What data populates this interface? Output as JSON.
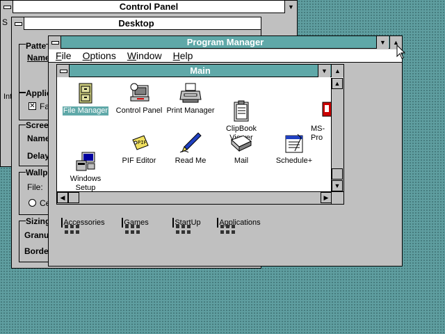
{
  "control_panel": {
    "title": "Control Panel",
    "partial_left_text": "Int",
    "partial_edge_text": "S"
  },
  "desktop": {
    "title": "Desktop",
    "pattern_label": "Patte",
    "name_label": "Name",
    "applications_label": "Applic",
    "fast_label": "Fa",
    "screensaver_label": "Scree",
    "name2_label": "Name",
    "delay_label": "Delay",
    "wallpaper_label": "Wallp",
    "file_label": "File:",
    "center_label": "Ce",
    "sizing_label": "Sizing",
    "granularity_label": "Granu",
    "border_label": "Borde"
  },
  "program_manager": {
    "title": "Program Manager",
    "menu": [
      "File",
      "Options",
      "Window",
      "Help"
    ]
  },
  "main_group": {
    "title": "Main",
    "items": [
      {
        "label": "File Manager",
        "icon": "file-cabinet-icon",
        "selected": true
      },
      {
        "label": "Control Panel",
        "icon": "control-panel-icon"
      },
      {
        "label": "Print Manager",
        "icon": "printer-icon"
      },
      {
        "label": "ClipBook\nViewer",
        "icon": "clipbook-icon"
      },
      {
        "label": "MS-\nPro",
        "icon": "ms-dos-icon"
      },
      {
        "label": "Windows\nSetup",
        "icon": "windows-setup-icon"
      },
      {
        "label": "PIF Editor",
        "icon": "pif-tag-icon"
      },
      {
        "label": "Read Me",
        "icon": "pen-icon"
      },
      {
        "label": "Mail",
        "icon": "mail-icon"
      },
      {
        "label": "Schedule+",
        "icon": "schedule-icon"
      }
    ]
  },
  "groups": [
    {
      "label": "Accessories"
    },
    {
      "label": "Games"
    },
    {
      "label": "StartUp"
    },
    {
      "label": "Applications"
    }
  ],
  "colors": {
    "desktop": "#5f9ea0",
    "active_title": "#5fa8a8",
    "window_face": "#c0c0c0"
  }
}
